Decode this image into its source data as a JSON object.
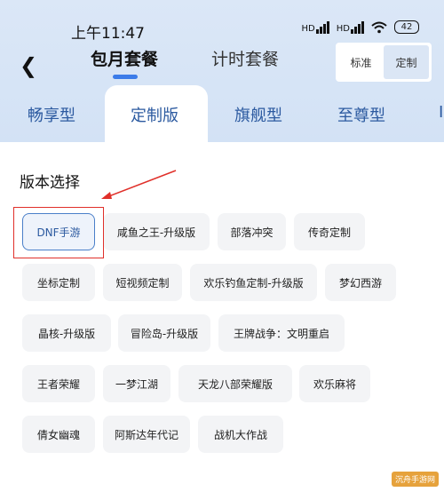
{
  "status_bar": {
    "time": "上午11:47",
    "signal1": "HD",
    "signal2": "HD",
    "battery": "42"
  },
  "header": {
    "tab_month": "包月套餐",
    "tab_time": "计时套餐",
    "segment": {
      "standard": "标准",
      "custom": "定制"
    }
  },
  "subtabs": [
    "畅享型",
    "定制版",
    "旗舰型",
    "至尊型"
  ],
  "section": {
    "title": "版本选择"
  },
  "chips": [
    "DNF手游",
    "咸鱼之王-升级版",
    "部落冲突",
    "传奇定制",
    "坐标定制",
    "短视频定制",
    "欢乐钓鱼定制-升级版",
    "梦幻西游",
    "晶核-升级版",
    "冒险岛-升级版",
    "王牌战争：文明重启",
    "王者荣耀",
    "一梦江湖",
    "天龙八部荣耀版",
    "欢乐麻将",
    "倩女幽魂",
    "阿斯达年代记",
    "战机大作战"
  ],
  "colors": {
    "accent": "#3b7be9",
    "highlight": "#e0302a"
  },
  "watermark": "沉舟手游网"
}
